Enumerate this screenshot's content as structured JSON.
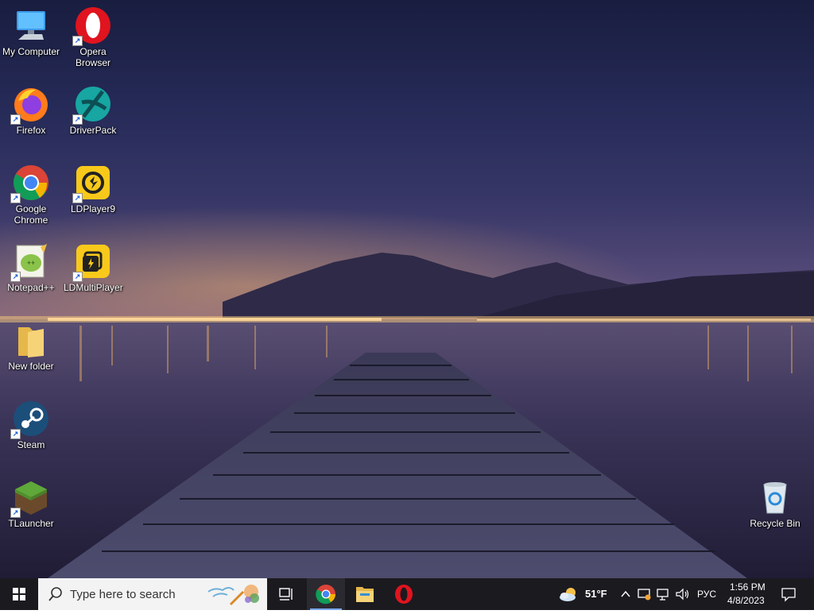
{
  "desktop": {
    "icons": [
      {
        "name": "my-computer",
        "label": "My Computer"
      },
      {
        "name": "opera-browser",
        "label": "Opera Browser"
      },
      {
        "name": "firefox",
        "label": "Firefox"
      },
      {
        "name": "driverpack",
        "label": "DriverPack"
      },
      {
        "name": "google-chrome",
        "label": "Google Chrome"
      },
      {
        "name": "ldplayer9",
        "label": "LDPlayer9"
      },
      {
        "name": "notepad-plus-plus",
        "label": "Notepad++"
      },
      {
        "name": "ldmultiplayer",
        "label": "LDMultiPlayer"
      },
      {
        "name": "new-folder",
        "label": "New folder"
      },
      {
        "name": "steam",
        "label": "Steam"
      },
      {
        "name": "tlauncher",
        "label": "TLauncher"
      },
      {
        "name": "recycle-bin",
        "label": "Recycle Bin"
      }
    ]
  },
  "taskbar": {
    "search_placeholder": "Type here to search",
    "pinned": [
      "task-view-icon",
      "chrome-icon",
      "file-explorer-icon",
      "opera-icon"
    ],
    "weather": {
      "temp": "51°F",
      "icon": "partly-cloudy-icon"
    },
    "language": "РУС",
    "time": "1:56 PM",
    "date": "4/8/2023"
  },
  "colors": {
    "taskbar": "#1b1a1f",
    "search_bg": "#f3f3f3",
    "active_indicator": "#79a8e8"
  }
}
